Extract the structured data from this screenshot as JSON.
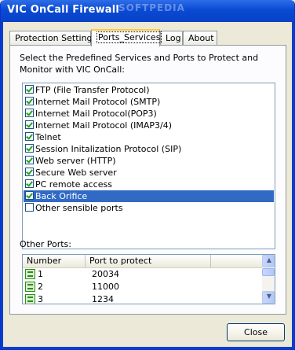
{
  "window": {
    "title": "VIC OnCall Firewall",
    "watermark": "SOFTPEDIA"
  },
  "tabs": [
    {
      "label": "Protection Settings",
      "active": false
    },
    {
      "label": "Ports_Services",
      "active": true
    },
    {
      "label": "Log",
      "active": false
    },
    {
      "label": "About",
      "active": false
    }
  ],
  "services": {
    "description": "Select the Predefined Services and Ports to Protect and Monitor with VIC OnCall:",
    "items": [
      {
        "label": "FTP (File Transfer Protocol)",
        "checked": true,
        "selected": false
      },
      {
        "label": "Internet Mail Protocol (SMTP)",
        "checked": true,
        "selected": false
      },
      {
        "label": "Internet Mail Protocol(POP3)",
        "checked": true,
        "selected": false
      },
      {
        "label": "Internet Mail Protocol (IMAP3/4)",
        "checked": true,
        "selected": false
      },
      {
        "label": "Telnet",
        "checked": true,
        "selected": false
      },
      {
        "label": "Session Initalization Protocol (SIP)",
        "checked": true,
        "selected": false
      },
      {
        "label": "Web server (HTTP)",
        "checked": true,
        "selected": false
      },
      {
        "label": "Secure Web server",
        "checked": true,
        "selected": false
      },
      {
        "label": "PC remote access",
        "checked": true,
        "selected": false
      },
      {
        "label": "Back Orifice",
        "checked": true,
        "selected": true
      },
      {
        "label": "Other sensible ports",
        "checked": false,
        "selected": false
      }
    ]
  },
  "other_ports": {
    "label": "Other Ports:",
    "columns": [
      "Number",
      "Port to protect"
    ],
    "rows": [
      {
        "number": "1",
        "port": "20034"
      },
      {
        "number": "2",
        "port": "11000"
      },
      {
        "number": "3",
        "port": "1234"
      }
    ]
  },
  "buttons": {
    "close": "Close"
  },
  "colors": {
    "selection": "#316ac5",
    "titlebar": "#0a4ad3",
    "tab_highlight": "#ffc83c"
  }
}
